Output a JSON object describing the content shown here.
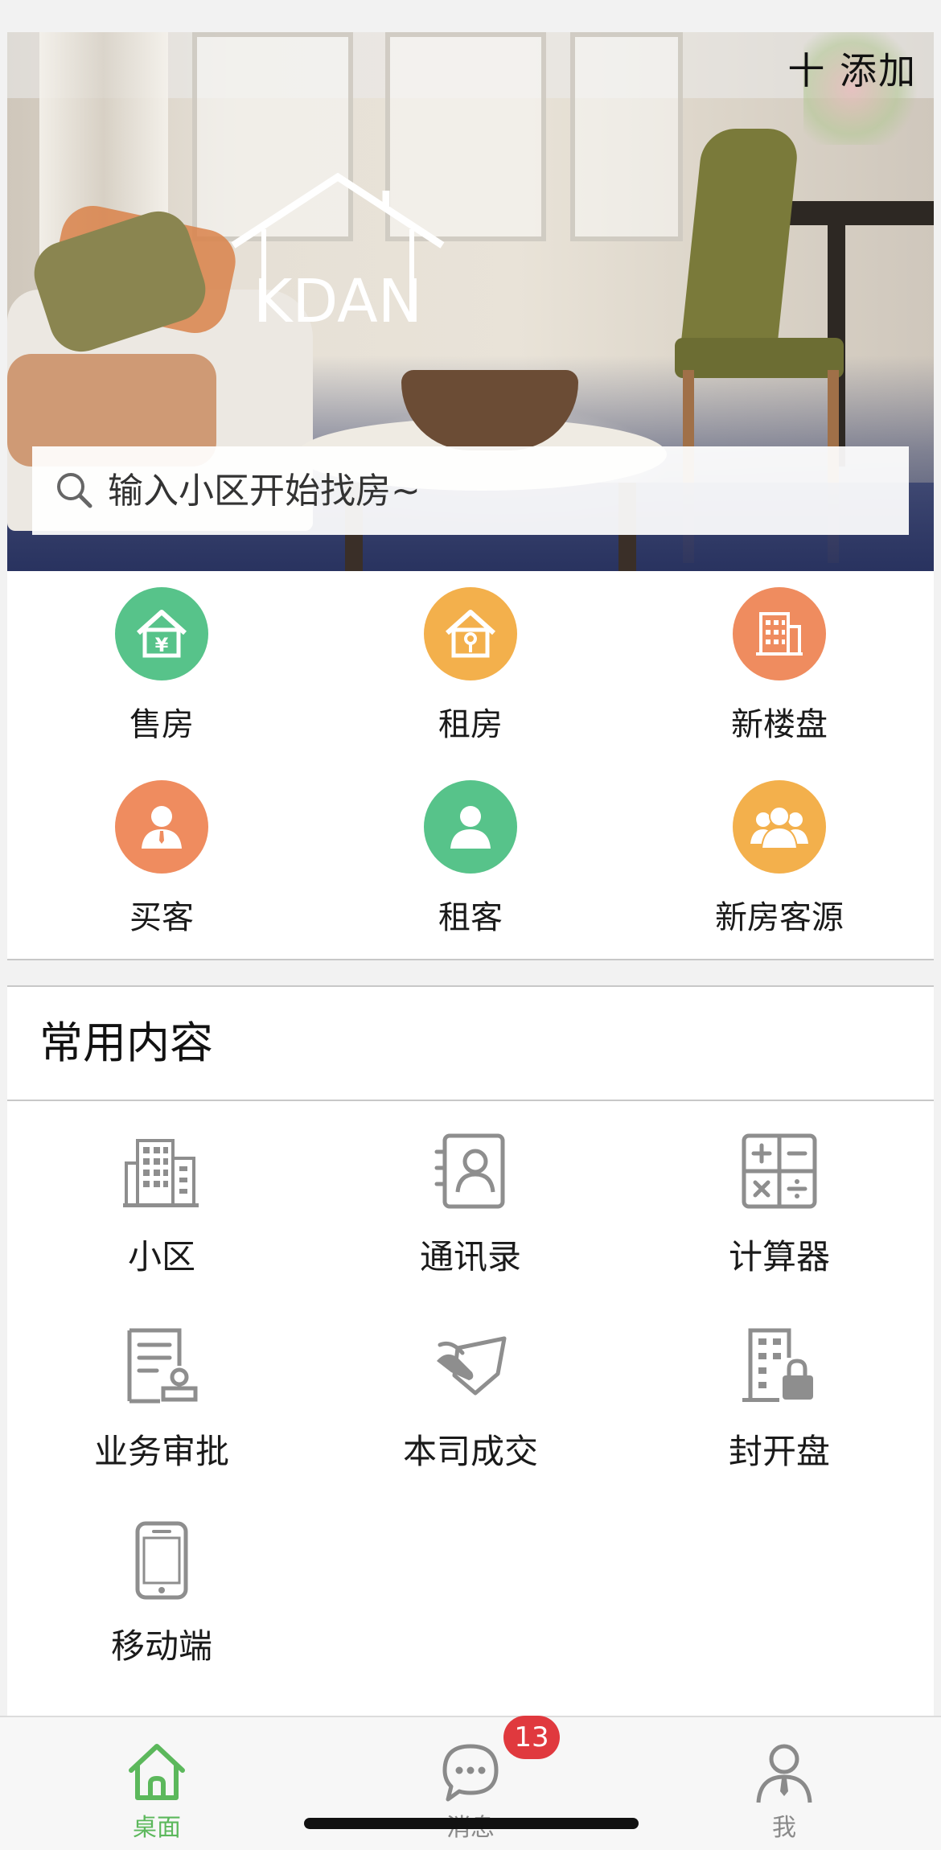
{
  "header": {
    "add_label": "十 添加",
    "logo_text": "KDAN"
  },
  "search": {
    "placeholder": "输入小区开始找房~"
  },
  "quick_actions": [
    {
      "label": "售房",
      "icon": "house-yen-icon",
      "color": "#57c38a"
    },
    {
      "label": "租房",
      "icon": "house-key-icon",
      "color": "#f3b04c"
    },
    {
      "label": "新楼盘",
      "icon": "building-icon",
      "color": "#ef8c5f"
    },
    {
      "label": "买客",
      "icon": "person-icon",
      "color": "#ef8c5f"
    },
    {
      "label": "租客",
      "icon": "person-icon",
      "color": "#57c38a"
    },
    {
      "label": "新房客源",
      "icon": "group-icon",
      "color": "#f3b04c"
    }
  ],
  "common": {
    "title": "常用内容",
    "items": [
      {
        "label": "小区",
        "icon": "community-building-icon"
      },
      {
        "label": "通讯录",
        "icon": "contacts-icon"
      },
      {
        "label": "计算器",
        "icon": "calculator-icon"
      },
      {
        "label": "业务审批",
        "icon": "approval-icon"
      },
      {
        "label": "本司成交",
        "icon": "deal-handshake-icon"
      },
      {
        "label": "封开盘",
        "icon": "locked-building-icon"
      },
      {
        "label": "移动端",
        "icon": "mobile-phone-icon"
      }
    ]
  },
  "tabbar": {
    "tabs": [
      {
        "label": "桌面",
        "icon": "home-icon",
        "active": true
      },
      {
        "label": "消息",
        "icon": "chat-bubble-icon",
        "active": false
      },
      {
        "label": "我",
        "icon": "user-profile-icon",
        "active": false
      }
    ],
    "message_badge": "13",
    "active_color": "#5cb85c",
    "inactive_color": "#8a8a8a"
  }
}
